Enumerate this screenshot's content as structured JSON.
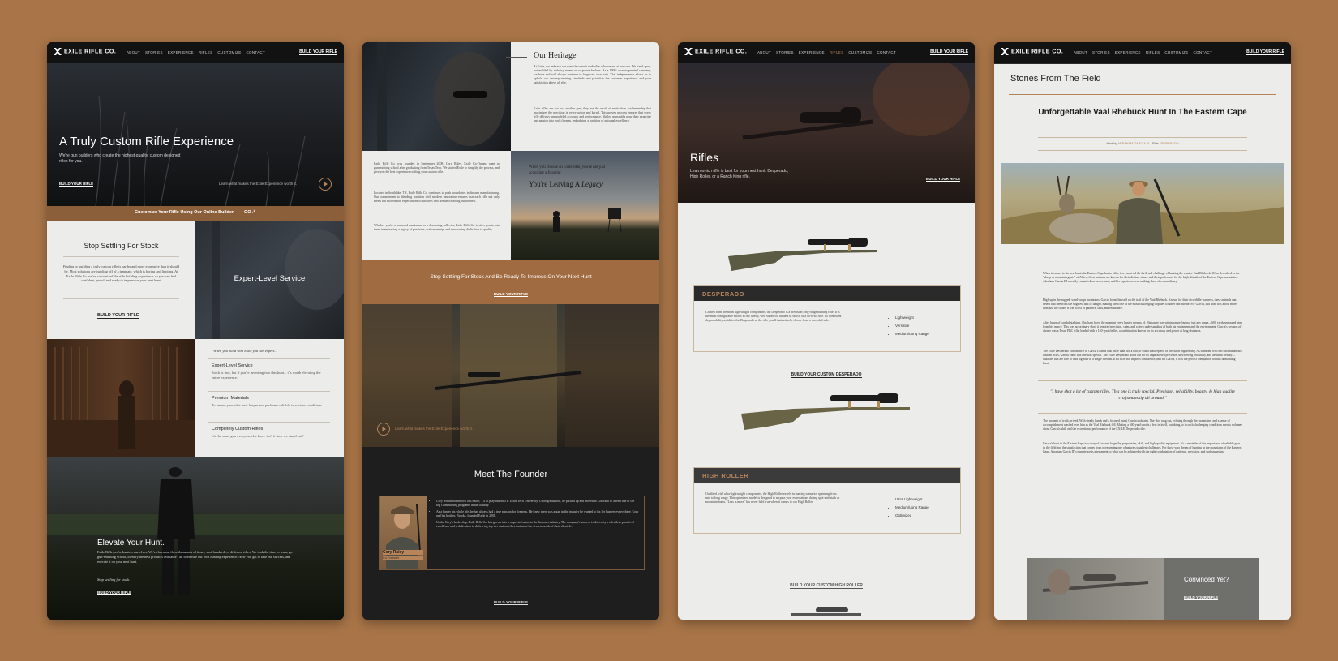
{
  "colors": {
    "background": "#a97548",
    "accent": "#b5835a",
    "dark": "#121212",
    "light": "#ececeb"
  },
  "nav": {
    "logo": "EXILE RIFLE CO.",
    "links": [
      "ABOUT",
      "STORIES",
      "EXPERIENCE",
      "RIFLES",
      "CUSTOMIZE",
      "CONTACT"
    ],
    "cta": "BUILD YOUR RIFLE"
  },
  "home": {
    "hero_title": "A Truly Custom Rifle Experience",
    "hero_sub": "We're gun builders who create the highest-quality, custom designed rifles for you.",
    "hero_cta": "BUILD YOUR RIFLE",
    "hero_video_label": "Learn what makes the Exile Experience worth it.",
    "banner_text": "Customize Your Rifle Using Our Online Builder",
    "banner_link": "GO",
    "stock_title": "Stop Settling For Stock",
    "stock_body": "Finding or building a truly custom rifle is harder and more expensive than it should be. Most solutions are building off of a template, which is boring and limiting. At Exile Rifle Co. we've customized the rifle building experience, so you can feel confident, proud, and ready to impress on your next hunt.",
    "stock_cta": "BUILD YOUR RIFLE",
    "expert_title": "Expert-Level Service",
    "expect_intro": "When you build with Exile you can expect...",
    "features": [
      {
        "title": "Expert-Level Service",
        "body": "Stock is fine, but if you're investing into this hunt... it's worth elevating the entire experience."
      },
      {
        "title": "Premium Materials",
        "body": "To ensure your rifle lasts longer and performs reliably in various conditions."
      },
      {
        "title": "Completely Custom Rifles",
        "body": "It's the same gun everyone else has... isn't it time we stand out?"
      }
    ],
    "elevate_title": "Elevate Your Hunt.",
    "elevate_body": "Exile Rifle, we're hunters ourselves. We've been out there thousands of times, shot hundreds of different rifles. We took the time to learn, go gun-smithing school, identify the best products available - all to elevate our own hunting experience. Now you get to take our success, and execute it on your next hunt.",
    "elevate_tag": "Stop settling for stock.",
    "elevate_cta": "BUILD YOUR RIFLE"
  },
  "about": {
    "heritage_title": "Our Heritage",
    "heritage_p1": "At Exile, we embrace our name because it embodies who we are at our core. We stand apart, not molded by industry norms or corporate backers. As a 100% owner-operated company, we have and will always continue to forge our own path. This independence allows us to uphold our uncompromising standards and prioritize the customer experience and your satisfaction above all else.",
    "heritage_p2": "Exile rifles are not just another gun; they are the result of meticulous craftsmanship that maximizes the precision in every action and barrel. This proven process ensures that every rifle delivers unparalleled accuracy and performance. Skilled gunsmiths pour their expertise and passion into each firearm, embodying a tradition of artisanal excellence.",
    "story_p1": "Exile Rifle Co. was founded in September 2008. Cory Raley, Exile Co-Owner, went to gunsmithing school after graduating from Texas Tech. We started Exile to simplify the process, and give you the best experience crafting your custom rifle.",
    "story_p2": "Located in Southlake, TX, Exile Rifle Co. continues to push boundaries in firearm manufacturing. Our commitment to blending tradition with modern innovation ensures that each rifle not only meets but exceeds the expectations of shooters who demand nothing but the best.",
    "story_p3": "Whether you're a seasoned marksman or a discerning collector, Exile Rifle Co. invites you to join them in embracing a legacy of precision, craftsmanship, and unwavering dedication to quality.",
    "legacy_small": "When you choose an Exile rifle, you're not just acquiring a firearm;",
    "legacy_big_1": "You're Leaving A",
    "legacy_big_2": "Legacy.",
    "cta_band_title": "Stop Settling For Stock And Be Ready To Impress On Your Next Hunt",
    "cta_band_link": "BUILD YOUR RIFLE",
    "video_label": "Learn what makes the Exile Experience worth it.",
    "founder_title": "Meet The Founder",
    "founder_name": "Cory Raley",
    "founder_role": "Co-Founder",
    "founder_bullets": [
      "Cory left his hometown of Uvalde, TX to play baseball at Texas Tech University. Upon graduation, he packed up and moved to Colorado to attend one of the top Gunsmithing programs in the country.",
      "As a hunter his whole life, he has always had a true passion for firearms. He knew there was a gap in the industry he wanted to fix for hunters everywhere. Cory and his brother, Brooks, founded Exile in 2008.",
      "Under Cory's leadership, Exile Rifle Co. has grown into a respected name in the firearms industry. The company's success is driven by a relentless pursuit of excellence and a dedication to delivering top-tier custom rifles that meet the diverse needs of their clientele."
    ],
    "founder_cta": "BUILD YOUR RIFLE"
  },
  "rifles": {
    "hero_title": "Rifles",
    "hero_sub": "Learn which rifle is best for your next hunt: Desperado, High Roller, or a Ranch King rifle.",
    "hero_cta": "BUILD YOUR RIFLE",
    "products": [
      {
        "name": "DESPERADO",
        "desc": "Crafted from premium lightweight components, the Desperado is a precision long-range hunting rifle. It is the most configurable model in our lineup, well suited for hunters in search of a do-it-all rifle. Its consistent dependability solidifies the Desperado as the rifle you'll instinctively choose from a crowded safe.",
        "features": [
          "Lightweight",
          "Versatile",
          "Medium/Long Range"
        ],
        "cta": "BUILD YOUR CUSTOM DESPERADO"
      },
      {
        "name": "HIGH ROLLER",
        "desc": "Outfitted with ultra-lightweight components, the High Roller excels in hunting scenarios spanning from mid to long range. This optimized model is designed to surpass your expectations during spot-and-stalk or mountain hunts. \"Less is more\" has never held true when it comes to our High Roller.",
        "features": [
          "Ultra Lightweight",
          "Medium/Long Range",
          "Optimized"
        ],
        "cta": "BUILD YOUR CUSTOM HIGH ROLLER"
      }
    ]
  },
  "story": {
    "section_title": "Stories From The Field",
    "title": "Unforgettable Vaal Rhebuck Hunt In The Eastern Cape",
    "meta_hunt_label": "Hunt by",
    "meta_hunt_value": "ABRAHAM GARCIA III",
    "meta_rifle_label": "Rifle",
    "meta_rifle_value": "DESPERADO",
    "p1": "When it comes to the best hunts the Eastern Cape has to offer, few can rival the thrill and challenge of hunting the elusive Vaal Rhebuck. Often described as the \"sheep or mountain goats\" of Africa, these animals are known for their distinct stance and their preference for the high altitude of the Eastern Cape mountains. Abraham Garcia III recently embarked on such a hunt, and his experience was nothing short of extraordinary.",
    "p2": "High up in the rugged, wind-swept mountains, Garcia found himself on the trail of the Vaal Rhebuck. Known for their incredible wariness, these animals can detect and flee from the slightest hint of danger, making them one of the most challenging trophies a hunter can pursue. For Garcia, this hunt was about more than just the chase; it was a test of patience, skill, and endurance.",
    "p3": "After hours of careful stalking, Abraham faced the moment every hunter dreams of. His target was within range, but not just any range—600 yards separated him from his quarry. This was no ordinary shot; it required precision, calm, and a deep understanding of both his equipment and the environment. Garcia's weapon of choice was a Texas FBC rifle, loaded with a 150-grain bullet, a combination known for its accuracy and power at long distances.",
    "p4": "The Exile Desperado custom rifle in Garcia's hands was more than just a tool; it was a masterpiece of precision engineering. As someone who has shot numerous custom rifles, Garcia knew this one was special. The Exile Desperado stood out for its unparalleled precision, unwavering reliability, and aesthetic beauty—qualities that are rare to find together in a single firearm. It's a rifle that inspires confidence, and for Garcia, it was the perfect companion for this demanding hunt.",
    "quote": "\"I have shot a lot of custom rifles. This one is truly special. Precision, reliability, beauty, & high quality craftsmanship all around.\"",
    "p5": "The moment of truth arrived. With steady hands and a focused mind, Garcia took aim. The shot rang out, echoing through the mountains, and a sense of accomplishment washed over him as the Vaal Rhebuck fell. Making a 600-yard shot is a feat in itself, but doing so in such challenging conditions speaks volumes about Garcia's skill and the exceptional performance of the EXILE Desperado rifle.",
    "p6": "Garcia's hunt in the Eastern Cape is a story of success forged by preparation, skill, and high-quality equipment. It's a reminder of the importance of reliable gear in the field and the satisfaction that comes from overcoming one of nature's toughest challenges. For those who dream of hunting in the mountains of the Eastern Cape, Abraham Garcia III's experience is a testament to what can be achieved with the right combination of patience, precision, and craftsmanship.",
    "convinced_title": "Convinced Yet?",
    "convinced_cta": "BUILD YOUR RIFLE"
  }
}
